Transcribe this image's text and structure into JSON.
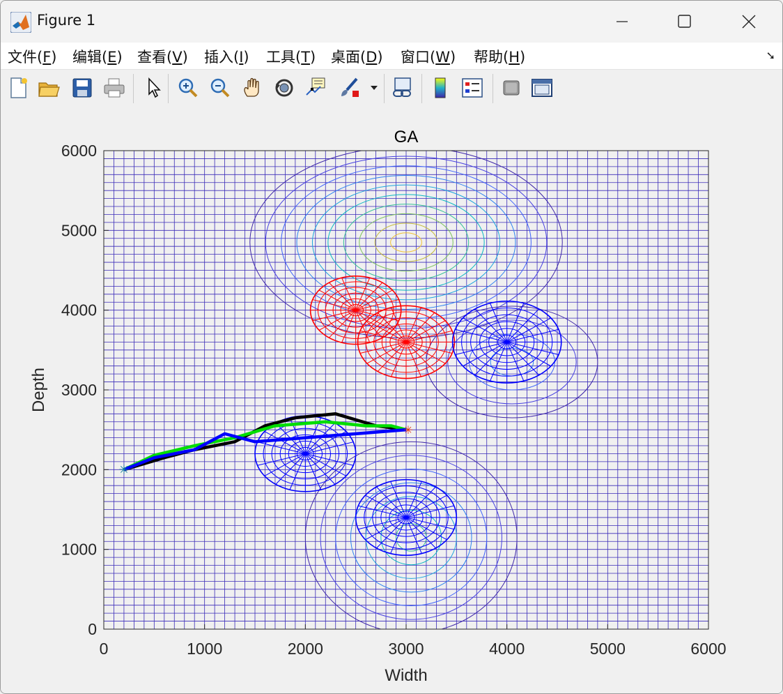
{
  "window": {
    "title": "Figure 1",
    "controls": {
      "minimize": "minimize",
      "maximize": "maximize",
      "close": "close"
    }
  },
  "menu": {
    "items": [
      {
        "label": "文件",
        "key": "F"
      },
      {
        "label": "编辑",
        "key": "E"
      },
      {
        "label": "查看",
        "key": "V"
      },
      {
        "label": "插入",
        "key": "I"
      },
      {
        "label": "工具",
        "key": "T"
      },
      {
        "label": "桌面",
        "key": "D"
      },
      {
        "label": "窗口",
        "key": "W"
      },
      {
        "label": "帮助",
        "key": "H"
      }
    ],
    "dock_icon": "dock-arrow-icon"
  },
  "toolbar": {
    "buttons": [
      "new-figure-icon",
      "open-file-icon",
      "save-icon",
      "print-icon",
      "select-arrow-icon",
      "zoom-in-icon",
      "zoom-out-icon",
      "pan-hand-icon",
      "rotate-3d-icon",
      "data-cursor-icon",
      "brush-icon",
      "link-plot-icon",
      "colorbar-icon",
      "legend-icon",
      "hide-plot-tools-icon",
      "show-plot-tools-icon"
    ]
  },
  "chart_data": {
    "type": "line",
    "title": "GA",
    "xlabel": "Width",
    "ylabel": "Depth",
    "xlim": [
      0,
      6000
    ],
    "ylim": [
      0,
      6000
    ],
    "xticks": [
      0,
      1000,
      2000,
      3000,
      4000,
      5000,
      6000
    ],
    "yticks": [
      0,
      1000,
      2000,
      3000,
      4000,
      5000,
      6000
    ],
    "grid": true,
    "background": "terrain mesh with contour lines (parula colors)",
    "obstacles": [
      {
        "center": [
          2500,
          4000
        ],
        "radius": 450,
        "color": "#ff0000"
      },
      {
        "center": [
          3000,
          3600
        ],
        "radius": 480,
        "color": "#ff0000"
      },
      {
        "center": [
          4000,
          3600
        ],
        "radius": 540,
        "color": "#0000ff"
      },
      {
        "center": [
          2000,
          2200
        ],
        "radius": 500,
        "color": "#0000ff"
      },
      {
        "center": [
          3000,
          1400
        ],
        "radius": 500,
        "color": "#0000ff"
      }
    ],
    "start": [
      200,
      2000
    ],
    "goal": [
      3000,
      2500
    ],
    "series": [
      {
        "color": "#000000",
        "x": [
          200,
          600,
          900,
          1300,
          1600,
          1900,
          2300,
          2700,
          3000
        ],
        "y": [
          2000,
          2150,
          2250,
          2350,
          2550,
          2650,
          2700,
          2550,
          2500
        ]
      },
      {
        "color": "#00dd00",
        "x": [
          200,
          500,
          900,
          1300,
          1700,
          2200,
          2600,
          2850,
          3000
        ],
        "y": [
          2000,
          2180,
          2300,
          2400,
          2550,
          2600,
          2550,
          2550,
          2500
        ]
      },
      {
        "color": "#0000ff",
        "x": [
          200,
          500,
          900,
          1200,
          1500,
          2000,
          2500,
          3000
        ],
        "y": [
          2000,
          2150,
          2250,
          2450,
          2350,
          2400,
          2450,
          2500
        ]
      }
    ]
  }
}
